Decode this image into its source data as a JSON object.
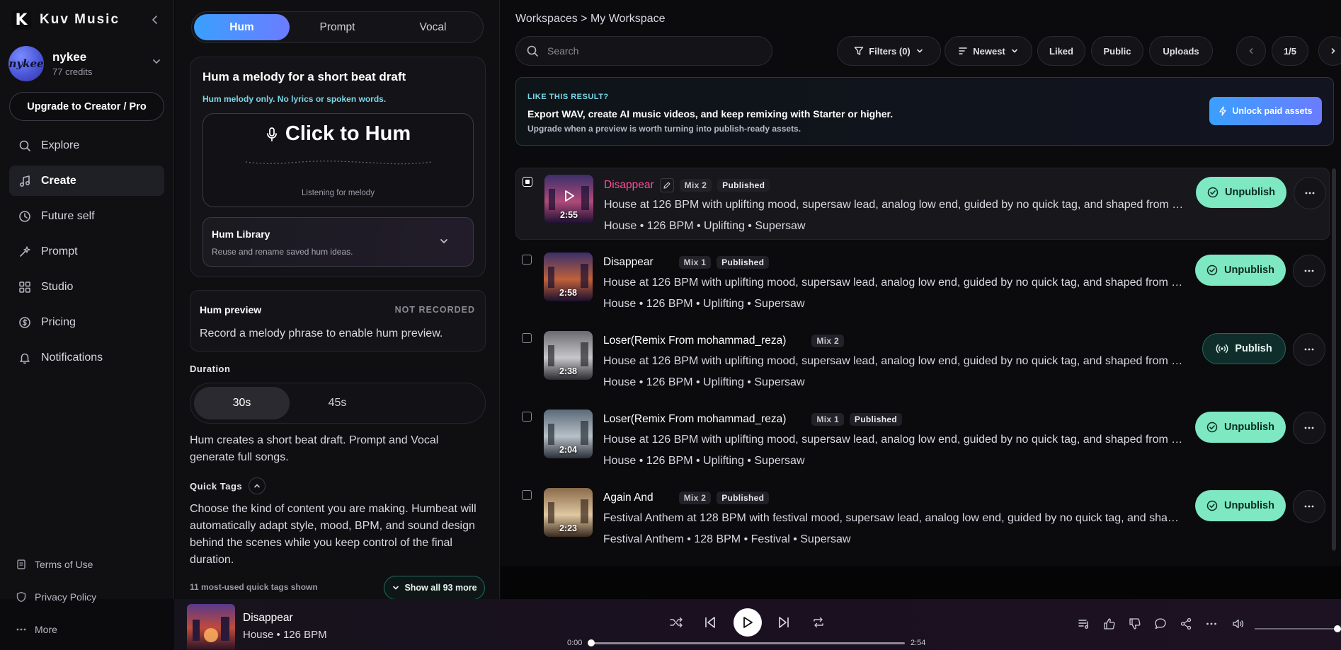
{
  "app": {
    "name": "Kuv Music",
    "logo_letter": "K"
  },
  "user": {
    "name": "nykee",
    "credits": "77 credits",
    "avatar_text": "nykee"
  },
  "sidebar": {
    "upgrade_label": "Upgrade to Creator / Pro",
    "nav": [
      {
        "label": "Explore",
        "icon": "search-icon"
      },
      {
        "label": "Create",
        "icon": "music-note-icon",
        "active": true
      },
      {
        "label": "Future self",
        "icon": "clock-icon"
      },
      {
        "label": "Prompt",
        "icon": "sparkle-icon"
      },
      {
        "label": "Studio",
        "icon": "grid-icon"
      },
      {
        "label": "Pricing",
        "icon": "coin-icon"
      },
      {
        "label": "Notifications",
        "icon": "bell-icon"
      }
    ],
    "footer": [
      {
        "label": "Terms of Use",
        "icon": "document-icon"
      },
      {
        "label": "Privacy Policy",
        "icon": "shield-icon"
      },
      {
        "label": "More",
        "icon": "more-dots-icon"
      }
    ]
  },
  "create": {
    "modes": [
      "Hum",
      "Prompt",
      "Vocal"
    ],
    "active_mode": "Hum",
    "hum": {
      "title": "Hum a melody for a short beat draft",
      "note": "Hum melody only. No lyrics or spoken words.",
      "button_label": "Click to Hum",
      "listening": "Listening for melody",
      "library_title": "Hum Library",
      "library_sub": "Reuse and rename saved hum ideas."
    },
    "preview": {
      "title": "Hum preview",
      "badge": "NOT RECORDED",
      "desc": "Record a melody phrase to enable hum preview."
    },
    "duration_label": "Duration",
    "durations": [
      "30s",
      "45s"
    ],
    "active_duration": "30s",
    "duration_help": "Hum creates a short beat draft. Prompt and Vocal generate full songs.",
    "quick_tags_label": "Quick Tags",
    "quick_tags_help": "Choose the kind of content you are making. Humbeat will automatically adapt style, mood, BPM, and sound design behind the scenes while you keep control of the final duration.",
    "quick_tags_count": "11 most-used quick tags shown",
    "show_all_label": "Show all 93 more"
  },
  "main": {
    "breadcrumb": "Workspaces > My Workspace",
    "search_placeholder": "Search",
    "filters_label": "Filters (0)",
    "sort_label": "Newest",
    "chips": [
      "Liked",
      "Public",
      "Uploads"
    ],
    "page": "1/5",
    "banner": {
      "kicker": "LIKE THIS RESULT?",
      "headline": "Export WAV, create AI music videos, and keep remixing with Starter or higher.",
      "sub": "Upgrade when a preview is worth turning into publish-ready assets.",
      "button": "Unlock paid assets"
    },
    "tracks": [
      {
        "title": "Disappear",
        "mix": "Mix 2",
        "status": "Published",
        "duration": "2:55",
        "desc": "House at 126 BPM with uplifting mood, supersaw lead, analog low end, guided by no quick tag, and shaped from your hummed melody",
        "meta": "House • 126 BPM • Uplifting • Supersaw",
        "action": "Unpublish",
        "selected": true
      },
      {
        "title": "Disappear",
        "mix": "Mix 1",
        "status": "Published",
        "duration": "2:58",
        "desc": "House at 126 BPM with uplifting mood, supersaw lead, analog low end, guided by no quick tag, and shaped from your hummed melody",
        "meta": "House • 126 BPM • Uplifting • Supersaw",
        "action": "Unpublish",
        "selected": false
      },
      {
        "title": "Loser(Remix From mohammad_reza)",
        "mix": "Mix 2",
        "status": "",
        "duration": "2:38",
        "desc": "House at 126 BPM with uplifting mood, supersaw lead, analog low end, guided by no quick tag, and shaped from your hummed melody",
        "meta": "House • 126 BPM • Uplifting • Supersaw",
        "action": "Publish",
        "selected": false
      },
      {
        "title": "Loser(Remix From mohammad_reza)",
        "mix": "Mix 1",
        "status": "Published",
        "duration": "2:04",
        "desc": "House at 126 BPM with uplifting mood, supersaw lead, analog low end, guided by no quick tag, and shaped from your hummed melody",
        "meta": "House • 126 BPM • Uplifting • Supersaw",
        "action": "Unpublish",
        "selected": false
      },
      {
        "title": "Again And",
        "mix": "Mix 2",
        "status": "Published",
        "duration": "2:23",
        "desc": "Festival Anthem at 128 BPM with festival mood, supersaw lead, analog low end, guided by no quick tag, and shaped from your hummed melody",
        "meta": "Festival Anthem • 128 BPM • Festival • Supersaw",
        "action": "Unpublish",
        "selected": false
      }
    ]
  },
  "player": {
    "title": "Disappear",
    "sub": "House • 126 BPM",
    "current_time": "0:00",
    "total_time": "2:54",
    "progress": 0.0,
    "volume": 0.97
  },
  "colors": {
    "accent": "#3aa0ff",
    "accent2": "#6b7cff",
    "unpublish": "#7de8c2",
    "title_pink": "#ff4f9b",
    "info": "#7ad7e8"
  }
}
